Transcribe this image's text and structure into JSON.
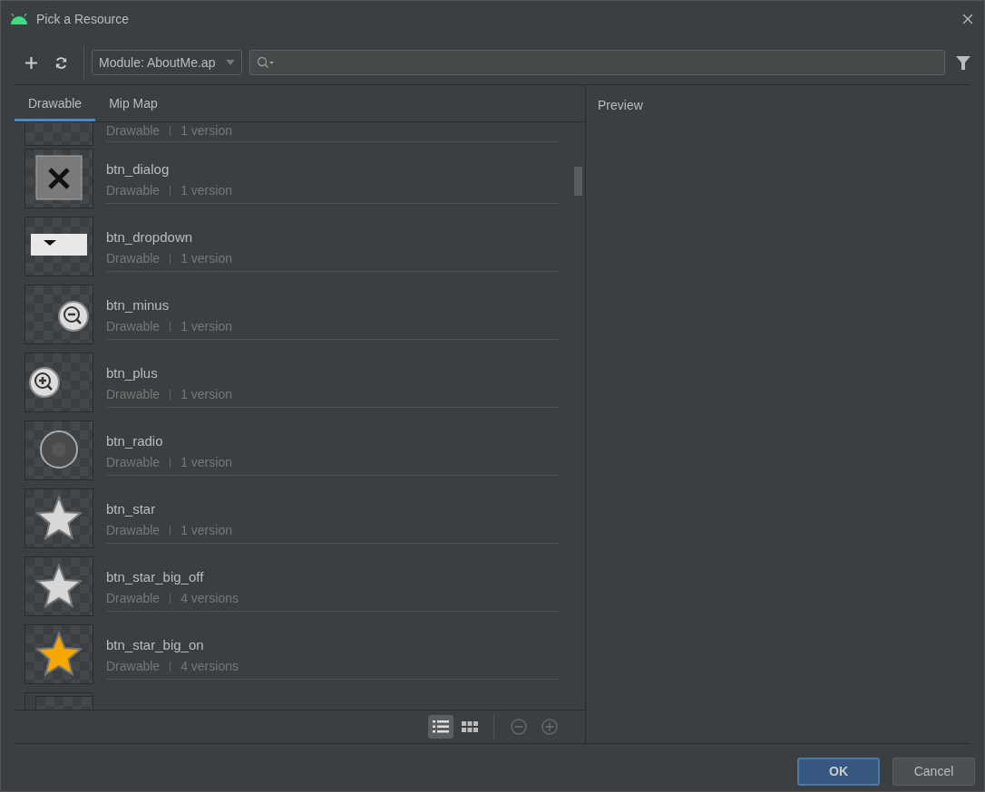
{
  "window": {
    "title": "Pick a Resource"
  },
  "toolbar": {
    "module": "Module: AboutMe.ap"
  },
  "tabs": [
    {
      "label": "Drawable",
      "selected": true
    },
    {
      "label": "Mip Map",
      "selected": false
    }
  ],
  "resources": [
    {
      "kind": "partial",
      "type": "Drawable",
      "versions": "1 version"
    },
    {
      "kind": "full",
      "name": "btn_dialog",
      "type": "Drawable",
      "versions": "1 version"
    },
    {
      "kind": "full",
      "name": "btn_dropdown",
      "type": "Drawable",
      "versions": "1 version"
    },
    {
      "kind": "full",
      "name": "btn_minus",
      "type": "Drawable",
      "versions": "1 version"
    },
    {
      "kind": "full",
      "name": "btn_plus",
      "type": "Drawable",
      "versions": "1 version"
    },
    {
      "kind": "full",
      "name": "btn_radio",
      "type": "Drawable",
      "versions": "1 version"
    },
    {
      "kind": "full",
      "name": "btn_star",
      "type": "Drawable",
      "versions": "1 version"
    },
    {
      "kind": "full",
      "name": "btn_star_big_off",
      "type": "Drawable",
      "versions": "4 versions"
    },
    {
      "kind": "full",
      "name": "btn_star_big_on",
      "type": "Drawable",
      "versions": "4 versions"
    },
    {
      "kind": "thumb"
    }
  ],
  "view_modes": [
    {
      "kind": "list",
      "selected": true
    },
    {
      "kind": "grid",
      "selected": false
    }
  ],
  "preview": {
    "label": "Preview"
  },
  "buttons": [
    {
      "label": "OK",
      "kind": "primary"
    },
    {
      "label": "Cancel",
      "kind": "secondary"
    }
  ]
}
